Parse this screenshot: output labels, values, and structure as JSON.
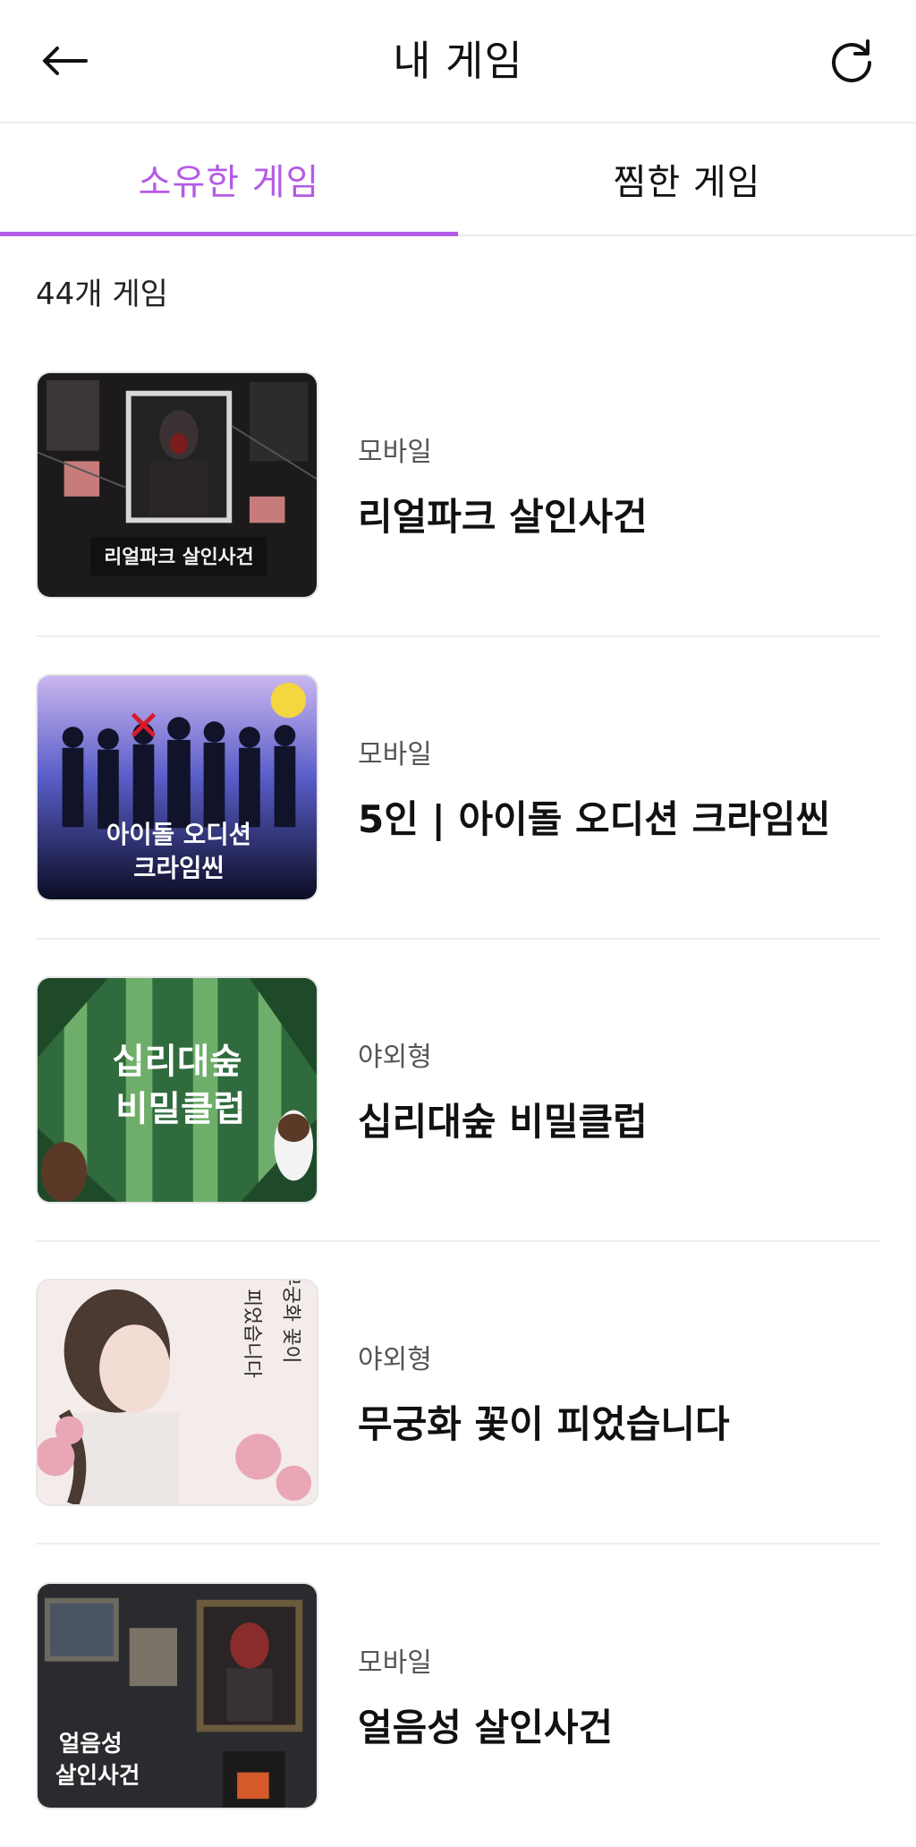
{
  "header": {
    "title": "내 게임",
    "back_icon": "arrow-left-icon",
    "refresh_icon": "refresh-icon"
  },
  "tabs": [
    {
      "label": "소유한 게임",
      "active": true
    },
    {
      "label": "찜한 게임",
      "active": false
    }
  ],
  "accent_color": "#b45be6",
  "count_label": "44개 게임",
  "games": [
    {
      "category": "모바일",
      "name": "리얼파크 살인사건",
      "thumb_text": [
        "리얼파크 살인사건"
      ]
    },
    {
      "category": "모바일",
      "name": "5인 | 아이돌 오디션 크라임씬",
      "thumb_text": [
        "아이돌 오디션",
        "크라임씬"
      ]
    },
    {
      "category": "야외형",
      "name": "십리대숲 비밀클럽",
      "thumb_text": [
        "십리대숲",
        "비밀클럽"
      ]
    },
    {
      "category": "야외형",
      "name": "무궁화 꽃이 피었습니다",
      "thumb_text": [
        "무궁화 꽃이",
        "피었습니다"
      ]
    },
    {
      "category": "모바일",
      "name": "얼음성 살인사건",
      "thumb_text": [
        "얼음성",
        "살인사건"
      ]
    }
  ]
}
